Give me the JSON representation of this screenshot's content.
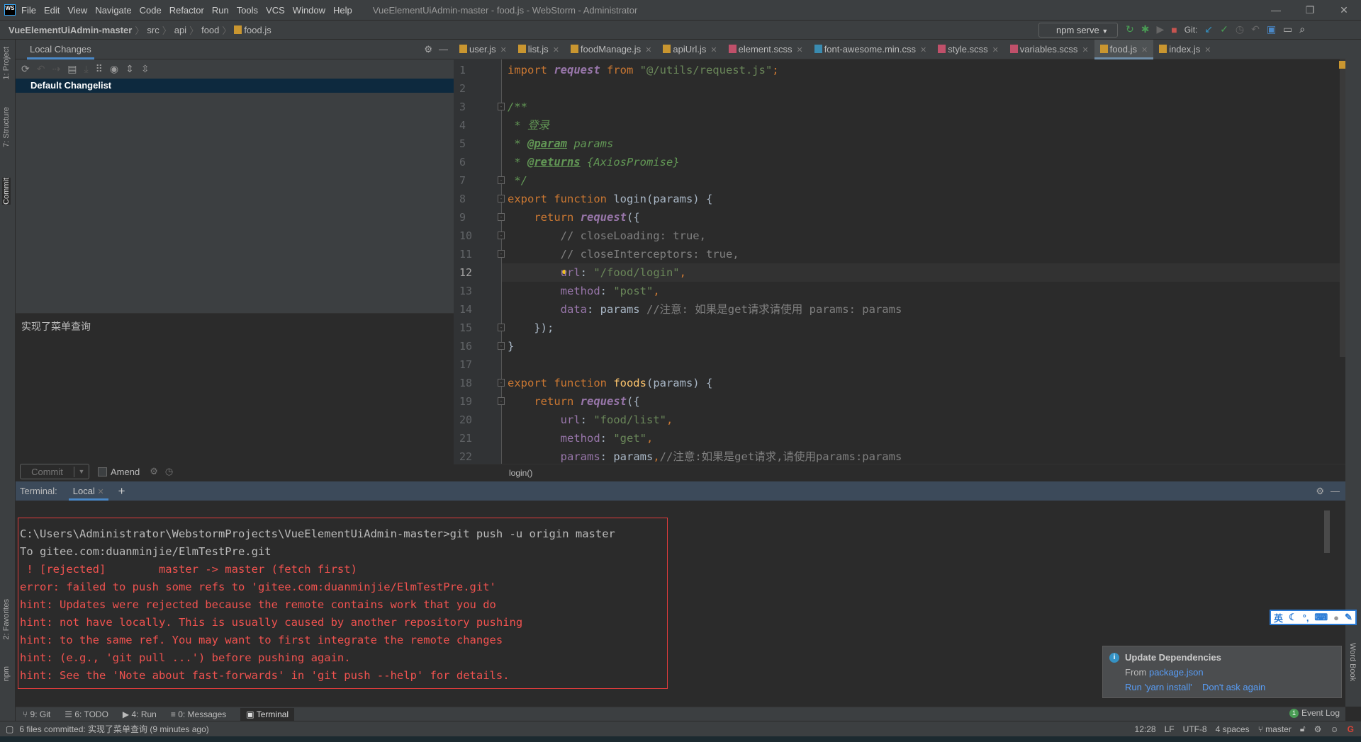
{
  "window": {
    "title": "VueElementUiAdmin-master - food.js - WebStorm - Administrator",
    "logo": "WS",
    "controls": [
      "—",
      "❐",
      "✕"
    ]
  },
  "menu": [
    "File",
    "Edit",
    "View",
    "Navigate",
    "Code",
    "Refactor",
    "Run",
    "Tools",
    "VCS",
    "Window",
    "Help"
  ],
  "breadcrumb": [
    "VueElementUiAdmin-master",
    "src",
    "api",
    "food",
    "food.js"
  ],
  "toolbar": {
    "run_config": "npm serve",
    "git_label": "Git:"
  },
  "left_stripe": [
    "1: Project",
    "7: Structure",
    "Commit",
    "2: Favorites",
    "npm"
  ],
  "right_stripe": [
    "Word Book"
  ],
  "commit_panel": {
    "tab": "Local Changes",
    "changelist": "Default Changelist",
    "message": "实现了菜单查询",
    "commit_label": "Commit",
    "amend_label": "Amend"
  },
  "editor_tabs": [
    {
      "name": "user.js",
      "type": "js"
    },
    {
      "name": "list.js",
      "type": "js"
    },
    {
      "name": "foodManage.js",
      "type": "js"
    },
    {
      "name": "apiUrl.js",
      "type": "js"
    },
    {
      "name": "element.scss",
      "type": "sass"
    },
    {
      "name": "font-awesome.min.css",
      "type": "css"
    },
    {
      "name": "style.scss",
      "type": "sass"
    },
    {
      "name": "variables.scss",
      "type": "sass"
    },
    {
      "name": "food.js",
      "type": "js",
      "active": true
    },
    {
      "name": "index.js",
      "type": "js"
    }
  ],
  "code_lines": [
    [
      [
        "kw",
        "import "
      ],
      [
        "fn",
        "request"
      ],
      [
        "kw",
        " from "
      ],
      [
        "str",
        "\"@/utils/request.js\""
      ],
      [
        "kw",
        ";"
      ]
    ],
    [],
    [
      [
        "doc",
        "/**"
      ]
    ],
    [
      [
        "doc",
        " * 登录"
      ]
    ],
    [
      [
        "doc",
        " * "
      ],
      [
        "tag",
        "@param"
      ],
      [
        "doc",
        " params"
      ]
    ],
    [
      [
        "doc",
        " * "
      ],
      [
        "tag",
        "@returns"
      ],
      [
        "doc",
        " {AxiosPromise}"
      ]
    ],
    [
      [
        "doc",
        " */"
      ]
    ],
    [
      [
        "kw",
        "export function "
      ],
      [
        "fnm",
        "login"
      ],
      [
        "",
        "(params) {"
      ]
    ],
    [
      [
        "kw",
        "    return "
      ],
      [
        "fn",
        "request"
      ],
      [
        "",
        "({"
      ]
    ],
    [
      [
        "cm",
        "        // closeLoading: true,"
      ]
    ],
    [
      [
        "cm",
        "        // closeInterceptors: true,"
      ]
    ],
    [
      [
        "prop",
        "        url"
      ],
      [
        "",
        ": "
      ],
      [
        "str",
        "\"/food/login\""
      ],
      [
        "kw",
        ","
      ]
    ],
    [
      [
        "prop",
        "        method"
      ],
      [
        "",
        ": "
      ],
      [
        "str",
        "\"post\""
      ],
      [
        "kw",
        ","
      ]
    ],
    [
      [
        "prop",
        "        data"
      ],
      [
        "",
        ": params "
      ],
      [
        "cm",
        "//注意: 如果是get请求请使用 params: params"
      ]
    ],
    [
      [
        "",
        "    });"
      ]
    ],
    [
      [
        "",
        "}"
      ]
    ],
    [],
    [
      [
        "kw",
        "export function "
      ],
      [
        "fdef",
        "foods"
      ],
      [
        "",
        "(params) {"
      ]
    ],
    [
      [
        "kw",
        "    return "
      ],
      [
        "fn",
        "request"
      ],
      [
        "",
        "({"
      ]
    ],
    [
      [
        "prop",
        "        url"
      ],
      [
        "",
        ": "
      ],
      [
        "str",
        "\"food/list\""
      ],
      [
        "kw",
        ","
      ]
    ],
    [
      [
        "prop",
        "        method"
      ],
      [
        "",
        ": "
      ],
      [
        "str",
        "\"get\""
      ],
      [
        "kw",
        ","
      ]
    ],
    [
      [
        "prop",
        "        params"
      ],
      [
        "",
        ": params"
      ],
      [
        "kw",
        ","
      ],
      [
        "cm",
        "//注意:如果是get请求,请使用params:params"
      ]
    ]
  ],
  "current_line": 12,
  "editor_breadcrumb": "login()",
  "terminal": {
    "label": "Terminal:",
    "tab": "Local",
    "lines": [
      {
        "text": "C:\\Users\\Administrator\\WebstormProjects\\VueElementUiAdmin-master>git push -u origin master",
        "error": false
      },
      {
        "text": "To gitee.com:duanminjie/ElmTestPre.git",
        "error": false
      },
      {
        "text": " ! [rejected]        master -> master (fetch first)",
        "error": true
      },
      {
        "text": "error: failed to push some refs to 'gitee.com:duanminjie/ElmTestPre.git'",
        "error": true
      },
      {
        "text": "hint: Updates were rejected because the remote contains work that you do",
        "error": true
      },
      {
        "text": "hint: not have locally. This is usually caused by another repository pushing",
        "error": true
      },
      {
        "text": "hint: to the same ref. You may want to first integrate the remote changes",
        "error": true
      },
      {
        "text": "hint: (e.g., 'git pull ...') before pushing again.",
        "error": true
      },
      {
        "text": "hint: See the 'Note about fast-forwards' in 'git push --help' for details.",
        "error": true
      }
    ]
  },
  "tool_windows": [
    {
      "label": "9: Git",
      "icon": "git-icon"
    },
    {
      "label": "6: TODO",
      "icon": "todo-icon"
    },
    {
      "label": "4: Run",
      "icon": "run-icon"
    },
    {
      "label": "0: Messages",
      "icon": "messages-icon"
    },
    {
      "label": "Terminal",
      "icon": "terminal-icon",
      "active": true
    }
  ],
  "event_log": {
    "count": "1",
    "label": "Event Log"
  },
  "status": {
    "message": "6 files committed: 实现了菜单查询 (9 minutes ago)",
    "position": "12:28",
    "line_sep": "LF",
    "encoding": "UTF-8",
    "indent": "4 spaces",
    "branch": "master"
  },
  "notification": {
    "title": "Update Dependencies",
    "from_label": "From",
    "from_link": "package.json",
    "actions": [
      "Run 'yarn install'",
      "Don't ask again"
    ]
  },
  "ime": {
    "mode": "英"
  }
}
